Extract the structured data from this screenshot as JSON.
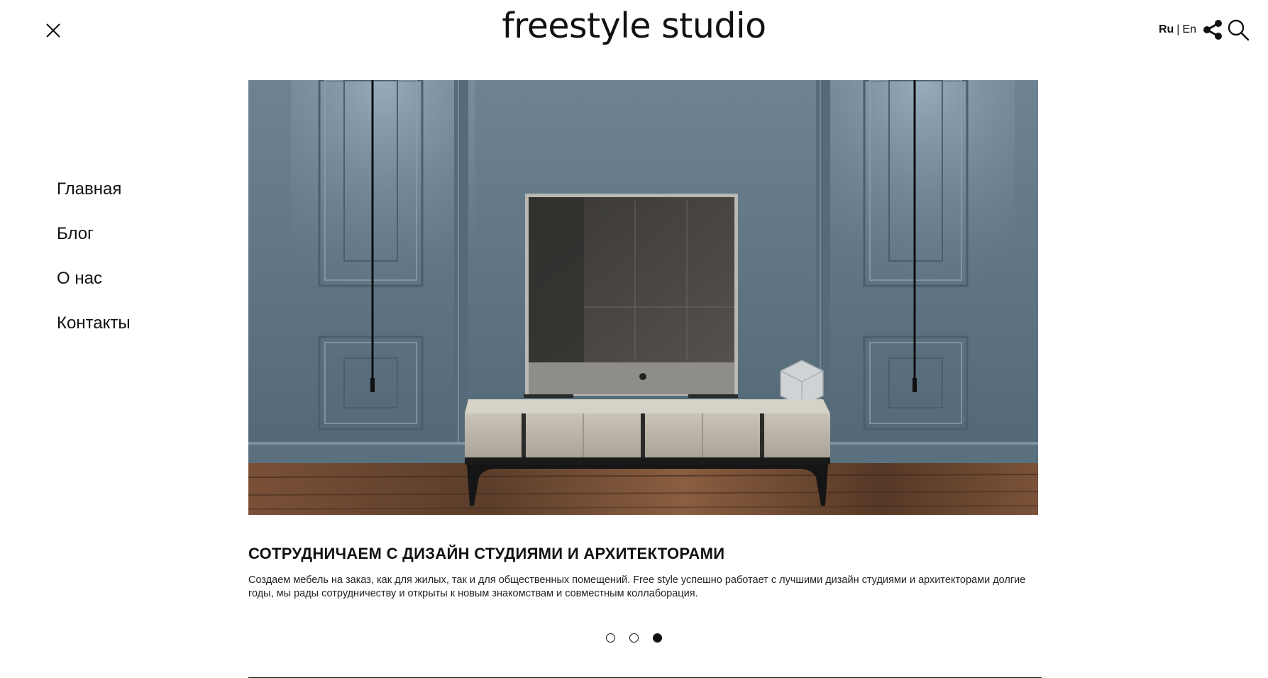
{
  "header": {
    "logo": "freestyle studio",
    "lang_ru": "Ru",
    "lang_sep": "|",
    "lang_en": "En",
    "icons": {
      "close": "close-icon",
      "share": "share-icon",
      "search": "search-icon"
    }
  },
  "menu": {
    "items": [
      {
        "label": "Главная"
      },
      {
        "label": "Блог"
      },
      {
        "label": "О нас"
      },
      {
        "label": "Контакты"
      }
    ]
  },
  "slide": {
    "title": "СОТРУДНИЧАЕМ С ДИЗАЙН СТУДИЯМИ И АРХИТЕКТОРАМИ",
    "text": "Создаем мебель на заказ, как для жилых, так и для общественных помещений. Free style успешно работает с лучшими дизайн студиями и архитекторами долгие годы, мы рады сотрудничеству и открыты к новым знакомствам и совместным коллаборация.",
    "image_alt": "tv-stand-interior-photo"
  },
  "pagination": {
    "count": 3,
    "active_index": 2
  },
  "colors": {
    "wall": "#5e7484",
    "floor": "#6a4a36",
    "cabinet": "#b8b3a6",
    "text": "#111111"
  }
}
